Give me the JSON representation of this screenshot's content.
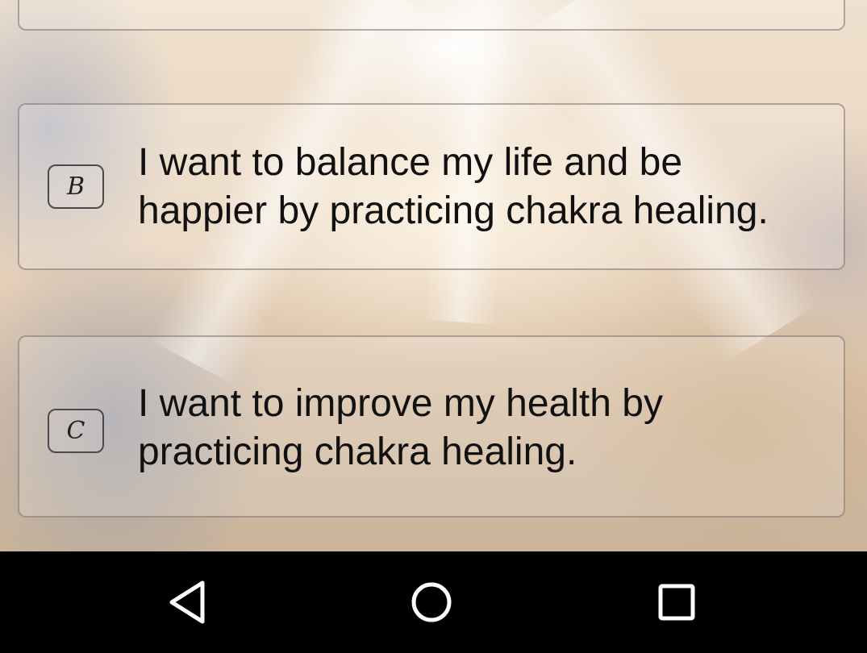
{
  "options": [
    {
      "letter": "B",
      "text": "I want to balance my life and be happier by practicing chakra healing."
    },
    {
      "letter": "C",
      "text": "I want to improve my health by practicing chakra healing."
    }
  ],
  "navbar": {
    "back_icon": "back-triangle-icon",
    "home_icon": "home-circle-icon",
    "recents_icon": "recents-square-icon"
  },
  "colors": {
    "navbar_bg": "#000000",
    "nav_icon": "#ffffff",
    "card_border": "#7a6e69",
    "text": "#111111"
  }
}
